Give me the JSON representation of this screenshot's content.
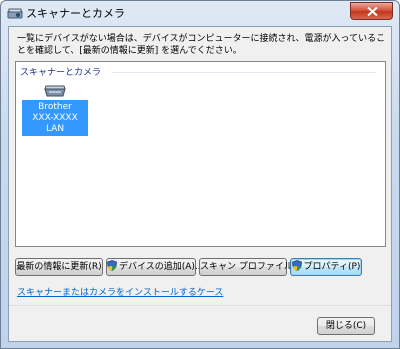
{
  "window": {
    "title": "スキャナーとカメラ",
    "close_icon": "close-icon",
    "title_icon": "scanner-camera-icon"
  },
  "description": "一覧にデバイスがない場合は、デバイスがコンピューターに接続され、電源が入っていることを確認して、[最新の情報に更新] を選んでください。",
  "list": {
    "group_header": "スキャナーとカメラ",
    "devices": [
      {
        "icon": "scanner-icon",
        "line1": "Brother",
        "line2": "XXX-XXXX",
        "line3": "LAN",
        "selected": true
      }
    ]
  },
  "buttons": {
    "refresh": "最新の情報に更新(R)",
    "add_device": "デバイスの追加(A)...",
    "scan_profiles": "スキャン プロファイル(S)",
    "properties": "プロパティ(P)"
  },
  "link": "スキャナーまたはカメラをインストールするケース",
  "footer": {
    "close": "閉じる(C)"
  },
  "colors": {
    "selection": "#3399ff",
    "link": "#0066cc",
    "close_button": "#c2361d"
  }
}
